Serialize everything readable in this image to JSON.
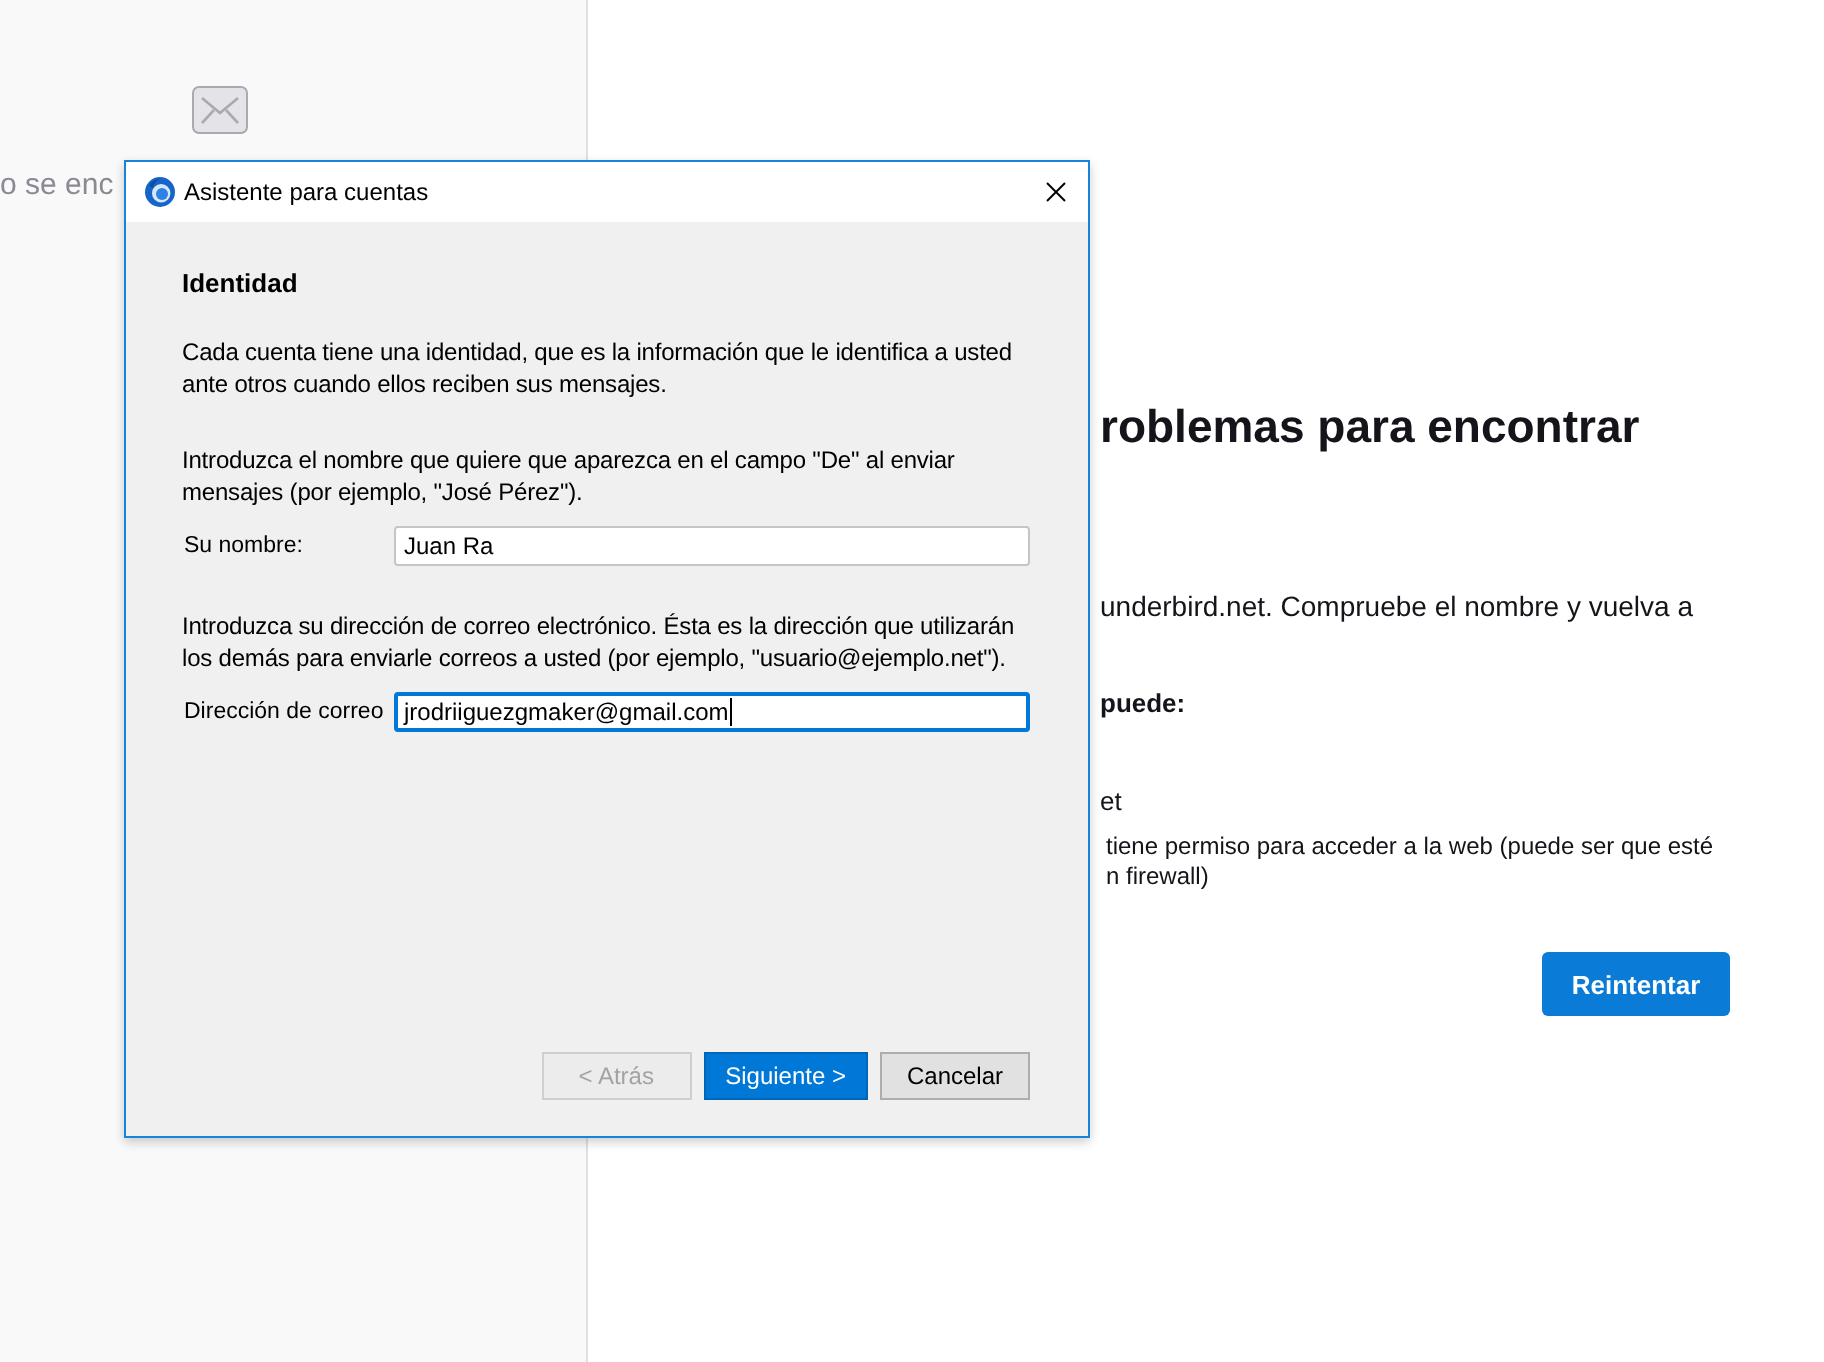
{
  "background": {
    "sidebar": {
      "message": "o se enc"
    },
    "main": {
      "heading": "roblemas para encontrar",
      "items": [
        {
          "kind": "text",
          "text": "underbird.net. Compruebe el nombre y vuelva a"
        },
        {
          "kind": "label",
          "text": "puede:"
        },
        {
          "kind": "item",
          "text": "et"
        },
        {
          "kind": "hint",
          "lines": [
            "tiene permiso para acceder a la web (puede ser que esté",
            "n firewall)"
          ]
        }
      ],
      "button": "Reintentar"
    }
  },
  "dialog": {
    "title": "Asistente para cuentas",
    "heading": "Identidad",
    "intro": "Cada cuenta tiene una identidad, que es la información que le identifica a usted ante otros cuando ellos reciben sus mensajes.",
    "fields": [
      {
        "description": "Introduzca el nombre que quiere que aparezca en el campo \"De\" al enviar mensajes (por ejemplo, \"José Pérez\").",
        "label": "Su nombre:",
        "value": "Juan Ra",
        "focused": false
      },
      {
        "description": "Introduzca su dirección de correo electrónico. Ésta es la dirección que utilizarán los demás para enviarle correos a usted (por ejemplo, \"usuario@ejemplo.net\").",
        "label": "Dirección de correo",
        "value": "jrodriiguezgmaker@gmail.com",
        "focused": true
      }
    ],
    "buttons": [
      {
        "label": "< Atrás",
        "disabled": true,
        "default": false
      },
      {
        "label": "Siguiente >",
        "disabled": false,
        "default": true
      },
      {
        "label": "Cancelar",
        "disabled": false,
        "default": false
      }
    ]
  }
}
